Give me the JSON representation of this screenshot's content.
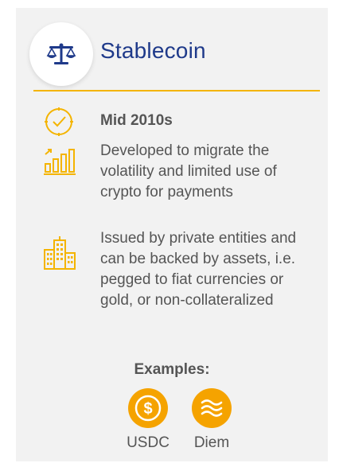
{
  "header": {
    "icon": "balance-scale-icon",
    "title": "Stablecoin"
  },
  "rows": [
    {
      "icon": "clock-check-icon",
      "text": "Mid 2010s"
    },
    {
      "icon": "growth-bar-chart-icon",
      "text": "Developed to migrate the volatility and limited use of crypto for payments"
    },
    {
      "icon": "buildings-icon",
      "text": "Issued by private entities and can be backed by assets, i.e. pegged to fiat currencies or gold, or non-collateralized"
    }
  ],
  "examples": {
    "label": "Examples:",
    "items": [
      {
        "icon": "dollar-coin-icon",
        "label": "USDC"
      },
      {
        "icon": "wave-coin-icon",
        "label": "Diem"
      }
    ]
  },
  "colors": {
    "accent": "#f4b400",
    "title": "#1f3a8a",
    "text": "#555555",
    "background": "#f2f2f2",
    "coin": "#f5a300"
  }
}
